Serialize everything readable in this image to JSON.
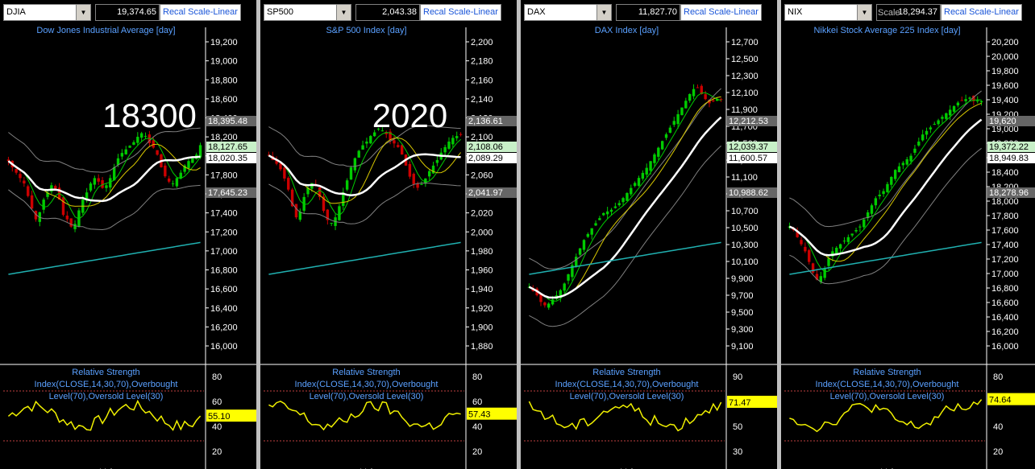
{
  "panels": [
    {
      "symbol": "DJIA",
      "price": "19,374.65",
      "recal_label": "Recal Scale-Linear",
      "chart_title": "Dow Jones Industrial Average [day]",
      "annotation": "18300",
      "axis_ticks": [
        "19,200",
        "19,000",
        "18,800",
        "18,600",
        "18,400",
        "18,200",
        "18,000",
        "17,800",
        "17,600",
        "17,400",
        "17,200",
        "17,000",
        "16,800",
        "16,600",
        "16,400",
        "16,200",
        "16,000"
      ],
      "price_labels": [
        {
          "text": "18,395.48",
          "style": "gray"
        },
        {
          "text": "18,127.65",
          "style": "green"
        },
        {
          "text": "18,020.35",
          "style": "white"
        },
        {
          "text": "17,645.23",
          "style": "gray"
        }
      ],
      "rsi_value": "55.10",
      "rsi_ticks": [
        "80",
        "60",
        "40",
        "20"
      ]
    },
    {
      "symbol": "SP500",
      "price": "2,043.38",
      "recal_label": "Recal Scale-Linear",
      "chart_title": "S&P 500 Index [day]",
      "annotation": "2020",
      "axis_ticks": [
        "2,200",
        "2,180",
        "2,160",
        "2,140",
        "2,120",
        "2,100",
        "2,080",
        "2,060",
        "2,040",
        "2,020",
        "2,000",
        "1,980",
        "1,960",
        "1,940",
        "1,920",
        "1,900",
        "1,880"
      ],
      "price_labels": [
        {
          "text": "2,136.61",
          "style": "gray"
        },
        {
          "text": "2,108.06",
          "style": "green"
        },
        {
          "text": "2,089.29",
          "style": "white"
        },
        {
          "text": "2,041.97",
          "style": "gray"
        }
      ],
      "rsi_value": "57.43",
      "rsi_ticks": [
        "80",
        "60",
        "40",
        "20"
      ]
    },
    {
      "symbol": "DAX",
      "price": "11,827.70",
      "recal_label": "Recal Scale-Linear",
      "chart_title": "DAX Index [day]",
      "annotation": "",
      "axis_ticks": [
        "12,700",
        "12,500",
        "12,300",
        "12,100",
        "11,900",
        "11,700",
        "11,500",
        "11,300",
        "11,100",
        "10,900",
        "10,700",
        "10,500",
        "10,300",
        "10,100",
        "9,900",
        "9,700",
        "9,500",
        "9,300",
        "9,100"
      ],
      "price_labels": [
        {
          "text": "12,212.53",
          "style": "gray"
        },
        {
          "text": "12,039.37",
          "style": "green"
        },
        {
          "text": "11,600.57",
          "style": "white"
        },
        {
          "text": "10,988.62",
          "style": "gray"
        }
      ],
      "rsi_value": "71.47",
      "rsi_ticks": [
        "90",
        "70",
        "50",
        "30"
      ]
    },
    {
      "symbol": "NIX",
      "price": "18,294.37",
      "recal_label": "Recal Scale-Linear",
      "chart_title": "Nikkei Stock Average 225 Index [day]",
      "annotation": "",
      "scale_ghost": "Scale",
      "axis_ticks": [
        "20,200",
        "20,000",
        "19,800",
        "19,600",
        "19,400",
        "19,200",
        "19,000",
        "18,800",
        "18,600",
        "18,400",
        "18,200",
        "18,000",
        "17,800",
        "17,600",
        "17,400",
        "17,200",
        "17,000",
        "16,800",
        "16,600",
        "16,400",
        "16,200",
        "16,000"
      ],
      "price_labels": [
        {
          "text": "19,620",
          "style": "gray"
        },
        {
          "text": "19,372.22",
          "style": "green"
        },
        {
          "text": "18,949.83",
          "style": "white"
        },
        {
          "text": "18,278.96",
          "style": "gray"
        }
      ],
      "rsi_value": "74.64",
      "rsi_ticks": [
        "80",
        "60",
        "40",
        "20"
      ]
    }
  ],
  "rsi_title_lines": [
    "Relative Strength",
    "Index(CLOSE,14,30,70),Overbought",
    "Level(70),Oversold Level(30)"
  ],
  "bottom_label": "Vol",
  "colors": {
    "background": "#000000",
    "up_candle": "#00cc00",
    "down_candle": "#cc0000",
    "ma_white": "#ffffff",
    "ma_yellow": "#d8c800",
    "ma_long": "#20b0b0",
    "bollinger": "#808080",
    "rsi_line": "#f0f000",
    "rsi_level": "#c04040",
    "axis_text": "#ffffff",
    "title_text": "#5aa0ff",
    "value_highlight": "#ffff00"
  },
  "chart_data": [
    {
      "type": "candlestick",
      "title": "Dow Jones Industrial Average [day]",
      "ylim": [
        15800,
        19350
      ],
      "close": [
        17950,
        17880,
        17820,
        17760,
        17700,
        17560,
        17420,
        17300,
        17380,
        17520,
        17600,
        17680,
        17640,
        17520,
        17350,
        17300,
        17220,
        17250,
        17400,
        17520,
        17600,
        17700,
        17760,
        17720,
        17650,
        17680,
        17760,
        17880,
        17980,
        18040,
        18080,
        18120,
        18160,
        18220,
        18260,
        18230,
        18150,
        18100,
        18020,
        17880,
        17780,
        17720,
        17700,
        17760,
        17820,
        17900,
        17950,
        17980,
        18020,
        18127
      ]
    },
    {
      "type": "candlestick",
      "title": "S&P 500 Index [day]",
      "ylim": [
        1870,
        2215
      ],
      "close": [
        2085,
        2080,
        2076,
        2070,
        2060,
        2048,
        2030,
        2018,
        2024,
        2040,
        2050,
        2055,
        2052,
        2040,
        2025,
        2015,
        2012,
        2018,
        2030,
        2045,
        2058,
        2072,
        2082,
        2090,
        2096,
        2100,
        2106,
        2110,
        2114,
        2112,
        2108,
        2102,
        2098,
        2094,
        2086,
        2074,
        2062,
        2054,
        2050,
        2054,
        2060,
        2068,
        2074,
        2080,
        2088,
        2094,
        2100,
        2104,
        2106,
        2108
      ]
    },
    {
      "type": "candlestick",
      "title": "DAX Index [day]",
      "ylim": [
        9000,
        12800
      ],
      "close": [
        9800,
        9750,
        9700,
        9620,
        9580,
        9600,
        9650,
        9700,
        9760,
        9840,
        9950,
        10060,
        10160,
        10260,
        10360,
        10430,
        10500,
        10560,
        10620,
        10680,
        10700,
        10720,
        10760,
        10800,
        10860,
        10920,
        10980,
        11040,
        11100,
        11160,
        11220,
        11300,
        11380,
        11460,
        11540,
        11620,
        11700,
        11780,
        11860,
        11940,
        12020,
        12100,
        12160,
        12180,
        12100,
        12040,
        11990,
        12020,
        12039,
        12039
      ]
    },
    {
      "type": "candlestick",
      "title": "Nikkei Stock Average 225 Index [day]",
      "ylim": [
        15800,
        20300
      ],
      "close": [
        17600,
        17550,
        17450,
        17350,
        17250,
        17100,
        16950,
        16850,
        16900,
        17000,
        17150,
        17250,
        17300,
        17350,
        17400,
        17450,
        17500,
        17550,
        17600,
        17700,
        17800,
        17900,
        18000,
        18050,
        18100,
        18200,
        18300,
        18400,
        18450,
        18500,
        18550,
        18600,
        18700,
        18800,
        18900,
        18950,
        19000,
        19050,
        19100,
        19150,
        19200,
        19250,
        19300,
        19350,
        19380,
        19400,
        19420,
        19372,
        19380,
        19372
      ]
    }
  ]
}
